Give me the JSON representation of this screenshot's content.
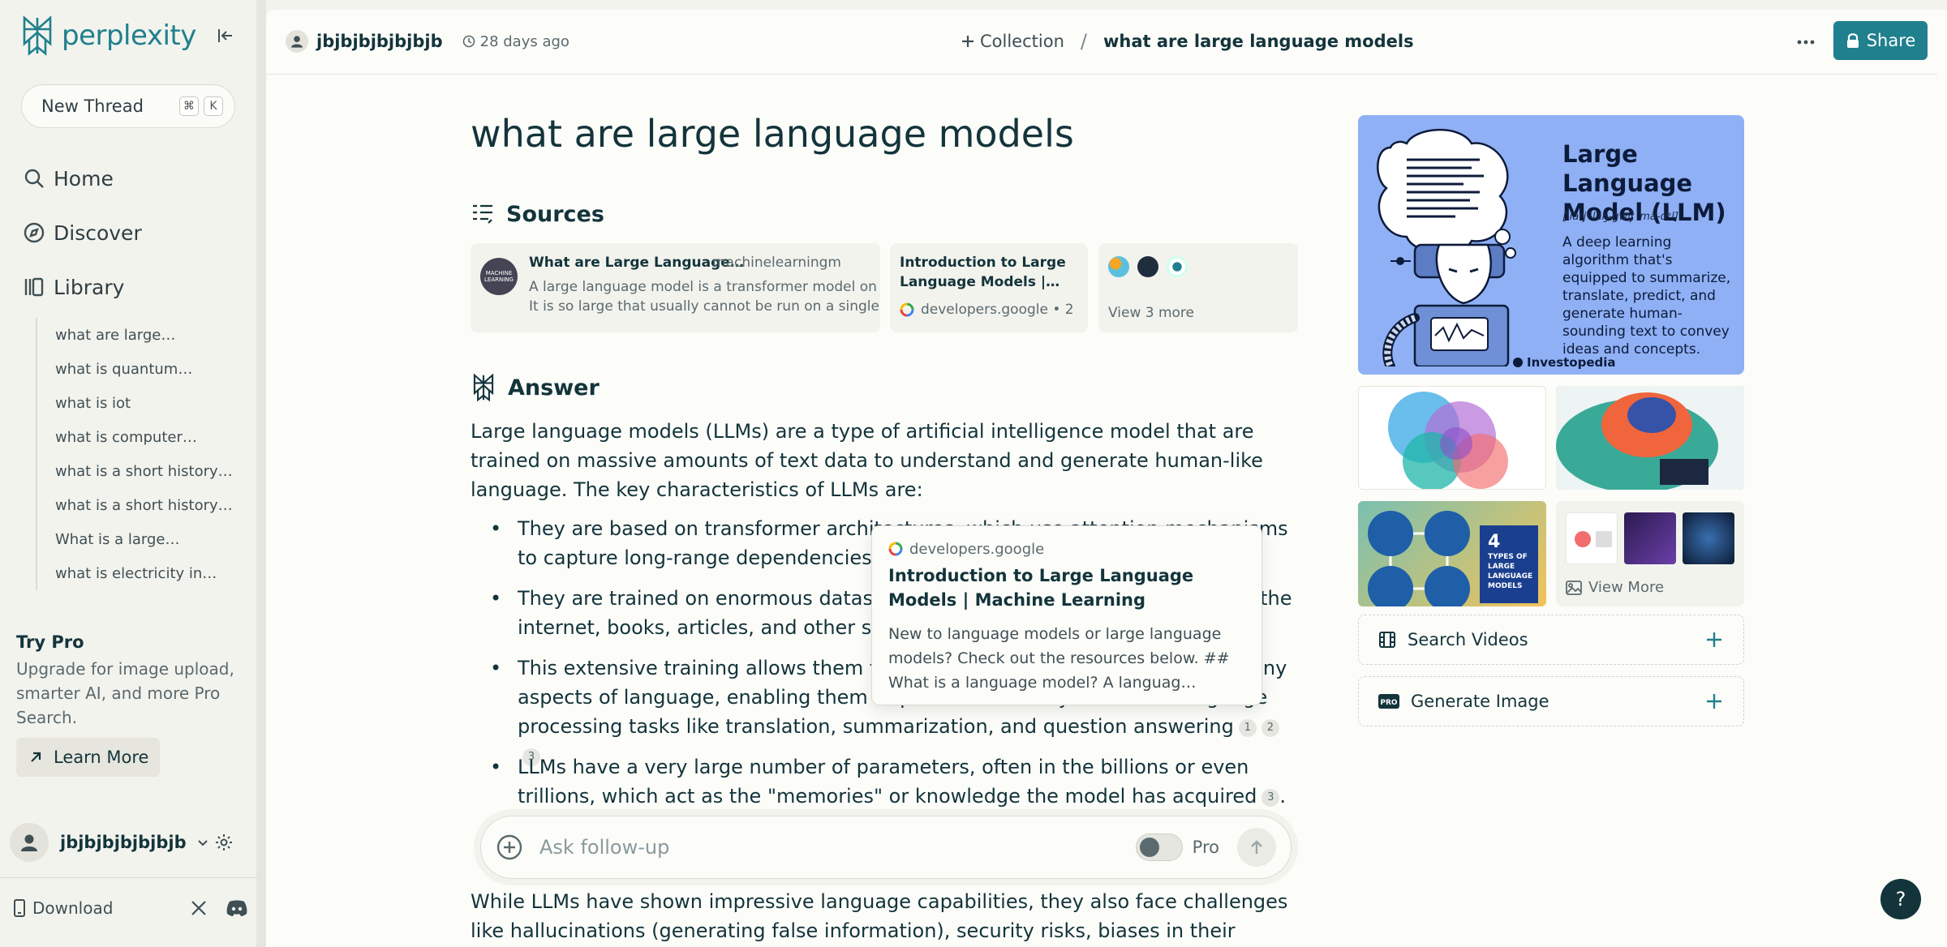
{
  "app": {
    "logo_text": "perplexity"
  },
  "sidebar": {
    "new_thread_label": "New Thread",
    "shortcut_keys": [
      "⌘",
      "K"
    ],
    "nav": [
      {
        "label": "Home",
        "icon": "search-icon"
      },
      {
        "label": "Discover",
        "icon": "compass-icon"
      },
      {
        "label": "Library",
        "icon": "library-icon"
      }
    ],
    "library_items": [
      "what are large…",
      "what is quantum…",
      "what is iot",
      "what is computer…",
      "what is a short history…",
      "what is a short history…",
      "What is a large…",
      "what is electricity in…"
    ],
    "try_pro": {
      "title": "Try Pro",
      "description": "Upgrade for image upload, smarter AI, and more Pro Search.",
      "cta": "Learn More"
    },
    "user_name": "jbjbjbjbjbjbjb",
    "download_label": "Download"
  },
  "topbar": {
    "username": "jbjbjbjbjbjbjb",
    "time": "28 days ago",
    "collection_label": "Collection",
    "separator": "/",
    "thread_title": "what are large language models",
    "share_label": "Share"
  },
  "thread": {
    "title": "what are large language models",
    "sources_heading": "Sources",
    "sources": [
      {
        "title": "What are Large Language…",
        "domain": "machinelearningm",
        "snippet_1": "A large language model is a transformer model on",
        "snippet_2": "It is so large that usually cannot be run on a single",
        "thumb_text": "MACHINE LEARNING"
      },
      {
        "title": "Introduction to Large Language Models |…",
        "domain": "developers.google • 2"
      },
      {
        "more_label": "View 3 more"
      }
    ],
    "answer_heading": "Answer",
    "intro": "Large language models (LLMs) are a type of artificial intelligence model that are trained on massive amounts of text data to understand and generate human-like language. The key characteristics of LLMs are:",
    "bullets": [
      {
        "text": "They are based on transformer architectures, which use attention mechanisms to capture long-range dependencies in language",
        "cites": []
      },
      {
        "text": "They are trained on enormous datasets, often containing text scraped from the internet, books, articles, and other sources",
        "cites": []
      },
      {
        "text": "This extensive training allows them to develop a broad understanding of many aspects of language, enabling them to perform a variety of natural language processing tasks like translation, summarization, and question answering",
        "cites": [
          "1",
          "2",
          "3"
        ]
      },
      {
        "text": "LLMs have a very large number of parameters, often in the billions or even trillions, which act as the \"memories\" or knowledge the model has acquired",
        "cites": [
          "3"
        ]
      }
    ],
    "followup_text": "While LLMs have shown impressive language capabilities, they also face challenges like hallucinations (generating false information), security risks, biases in their training data,",
    "popover": {
      "domain": "developers.google",
      "title": "Introduction to Large Language Models | Machine Learning",
      "snippet": "New to language models or large language models? Check out the resources below. ## What is a language model? A languag…"
    },
    "ask": {
      "placeholder": "Ask follow-up",
      "pro_label": "Pro"
    }
  },
  "right": {
    "hero": {
      "title": "Large Language Model (LLM)",
      "pronunciation": "[ˈlärj ˈlaŋ-gwij ˈmä-dᵊl]",
      "description": "A deep learning algorithm that's equipped to summarize, translate, predict, and generate human-sounding text to convey ideas and concepts.",
      "brand": "Investopedia"
    },
    "thumb_labels": {
      "types": "4",
      "types_caption": "TYPES OF LARGE LANGUAGE MODELS"
    },
    "view_more_label": "View More",
    "search_videos_label": "Search Videos",
    "generate_image_label": "Generate Image"
  },
  "colors": {
    "accent": "#20808d",
    "text": "#13343b",
    "sidebar_bg": "#f3f3ee",
    "main_bg": "#fcfcf9"
  }
}
